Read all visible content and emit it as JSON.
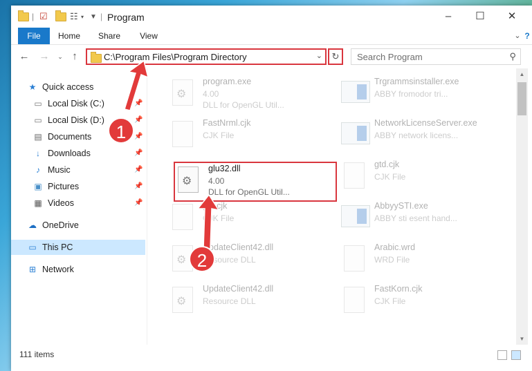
{
  "window": {
    "title": "Program"
  },
  "ribbon": {
    "tabs": [
      "File",
      "Home",
      "Share",
      "View"
    ]
  },
  "address": {
    "path": "C:\\Program Files\\Program Directory"
  },
  "search": {
    "placeholder": "Search Program"
  },
  "nav": {
    "items": [
      {
        "label": "Quick access",
        "icon": "star-icon",
        "pinned": false
      },
      {
        "label": "Local Disk (C:)",
        "icon": "drive-icon",
        "pinned": true
      },
      {
        "label": "Local Disk (D:)",
        "icon": "drive-icon",
        "pinned": true
      },
      {
        "label": "Documents",
        "icon": "documents-icon",
        "pinned": true
      },
      {
        "label": "Downloads",
        "icon": "download-icon",
        "pinned": true
      },
      {
        "label": "Music",
        "icon": "music-icon",
        "pinned": true
      },
      {
        "label": "Pictures",
        "icon": "pictures-icon",
        "pinned": true
      },
      {
        "label": "Videos",
        "icon": "videos-icon",
        "pinned": true
      },
      {
        "label": "OneDrive",
        "icon": "cloud-icon",
        "pinned": false
      },
      {
        "label": "This PC",
        "icon": "computer-icon",
        "pinned": false,
        "selected": true
      },
      {
        "label": "Network",
        "icon": "network-icon",
        "pinned": false
      }
    ]
  },
  "files": [
    {
      "name": "program.exe",
      "line2": "4.00",
      "line3": "DLL for OpenGL Util..."
    },
    {
      "name": "Trgrammsinstaller.exe",
      "line2": "ABBY fromodor tri...",
      "line3": ""
    },
    {
      "name": "FastNrml.cjk",
      "line2": "CJK File",
      "line3": ""
    },
    {
      "name": "NetworkLicenseServer.exe",
      "line2": "ABBY network licens...",
      "line3": ""
    },
    {
      "name": "glu32.dll",
      "line2": "4.00",
      "line3": "DLL for OpenGL Util..."
    },
    {
      "name": "gtd.cjk",
      "line2": "CJK File",
      "line3": ""
    },
    {
      "name": "glu.cjk",
      "line2": "CJK File",
      "line3": ""
    },
    {
      "name": "AbbyySTI.exe",
      "line2": "ABBY sti esent hand...",
      "line3": ""
    },
    {
      "name": "UpdateClient42.dll",
      "line2": "Resource DLL",
      "line3": ""
    },
    {
      "name": "Arabic.wrd",
      "line2": "WRD File",
      "line3": ""
    },
    {
      "name": "UpdateClient42.dll",
      "line2": "Resource DLL",
      "line3": ""
    },
    {
      "name": "FastKorn.cjk",
      "line2": "CJK File",
      "line3": ""
    }
  ],
  "status": {
    "count": "111 items"
  },
  "annotations": {
    "step1": "1",
    "step2": "2",
    "color": "#e23a3a"
  }
}
